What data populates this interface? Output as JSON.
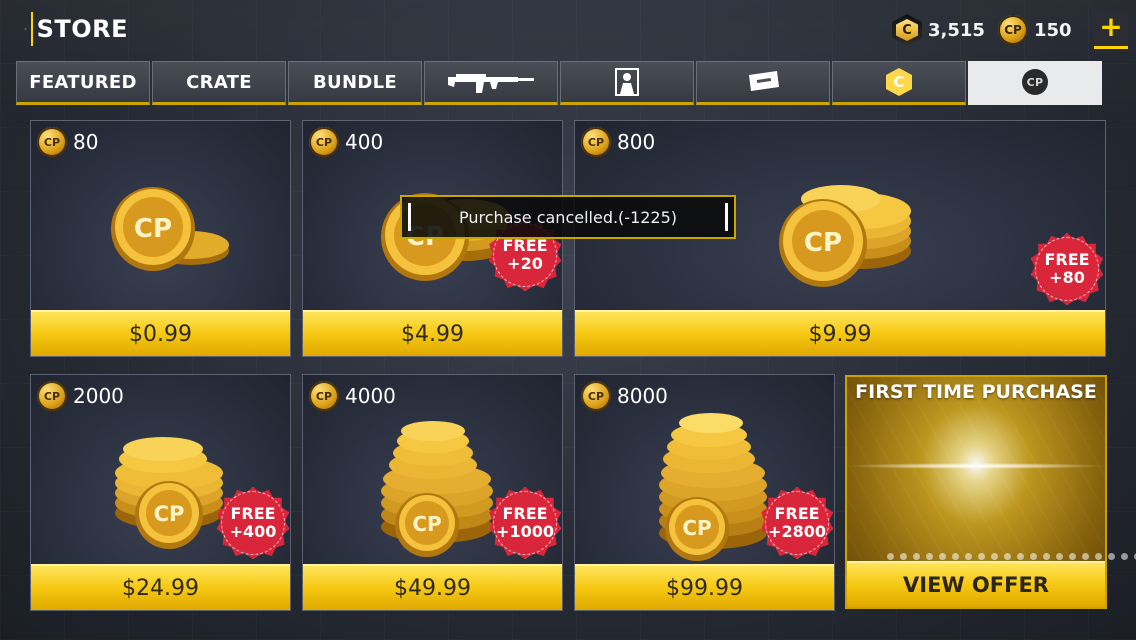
{
  "header": {
    "title": "STORE",
    "credits_value": "3,515",
    "cp_value": "150",
    "plus_label": "+"
  },
  "tabs": [
    {
      "label": "FEATURED",
      "icon": null,
      "active": false
    },
    {
      "label": "CRATE",
      "icon": null,
      "active": false
    },
    {
      "label": "BUNDLE",
      "icon": null,
      "active": false
    },
    {
      "label": "",
      "icon": "rifle-icon",
      "active": false
    },
    {
      "label": "",
      "icon": "character-icon",
      "active": false
    },
    {
      "label": "",
      "icon": "ticket-icon",
      "active": false
    },
    {
      "label": "C",
      "icon": "credits-icon",
      "active": false
    },
    {
      "label": "CP",
      "icon": "cod-points-icon",
      "active": true
    }
  ],
  "products": [
    {
      "amount": "80",
      "price": "$0.99",
      "free_line1": "",
      "free_line2": ""
    },
    {
      "amount": "400",
      "price": "$4.99",
      "free_line1": "FREE",
      "free_line2": "+20"
    },
    {
      "amount": "800",
      "price": "$9.99",
      "free_line1": "FREE",
      "free_line2": "+80"
    },
    {
      "amount": "2000",
      "price": "$24.99",
      "free_line1": "FREE",
      "free_line2": "+400"
    },
    {
      "amount": "4000",
      "price": "$49.99",
      "free_line1": "FREE",
      "free_line2": "+1000"
    },
    {
      "amount": "8000",
      "price": "$99.99",
      "free_line1": "FREE",
      "free_line2": "+2800"
    }
  ],
  "offer": {
    "title": "FIRST TIME PURCHASE",
    "button_label": "VIEW OFFER"
  },
  "toast": {
    "message": "Purchase cancelled.(-1225)"
  },
  "coin_label": "CP",
  "colors": {
    "accent": "#ffd400",
    "price_bar": "#f6c812",
    "free_badge": "#d9263a",
    "toast_border": "#c9a500"
  }
}
